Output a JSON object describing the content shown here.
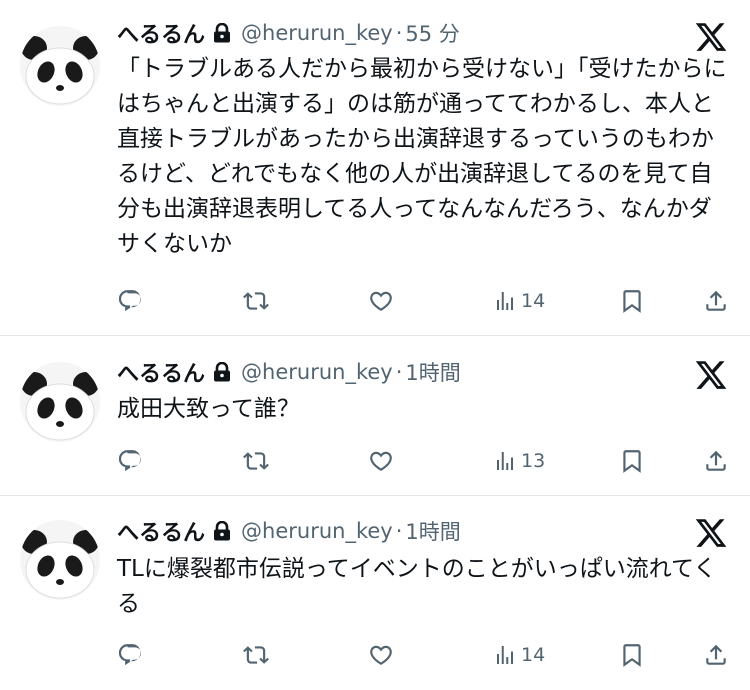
{
  "colors": {
    "text": "#0f1419",
    "secondary": "#536471",
    "divider": "#e6e6e6"
  },
  "tweets": [
    {
      "user": {
        "name": "へるるん",
        "handle": "@herurun_key"
      },
      "separator": "·",
      "time": "55 分",
      "text": "「トラブルある人だから最初から受けない」「受けたからにはちゃんと出演する」のは筋が通っててわかるし、本人と直接トラブルがあったから出演辞退するっていうのもわかるけど、どれでもなく他の人が出演辞退してるのを見て自分も出演辞退表明してる人ってなんなんだろう、なんかダサくないか",
      "views": "14",
      "icons": [
        "reply-icon",
        "retweet-icon",
        "like-icon",
        "views-icon",
        "bookmark-icon",
        "share-icon"
      ]
    },
    {
      "user": {
        "name": "へるるん",
        "handle": "@herurun_key"
      },
      "separator": "·",
      "time": "1時間",
      "text": "成田大致って誰？",
      "views": "13",
      "icons": [
        "reply-icon",
        "retweet-icon",
        "like-icon",
        "views-icon",
        "bookmark-icon",
        "share-icon"
      ]
    },
    {
      "user": {
        "name": "へるるん",
        "handle": "@herurun_key"
      },
      "separator": "·",
      "time": "1時間",
      "text": "TLに爆裂都市伝説ってイベントのことがいっぱい流れてくる",
      "views": "14",
      "icons": [
        "reply-icon",
        "retweet-icon",
        "like-icon",
        "views-icon",
        "bookmark-icon",
        "share-icon"
      ]
    }
  ]
}
